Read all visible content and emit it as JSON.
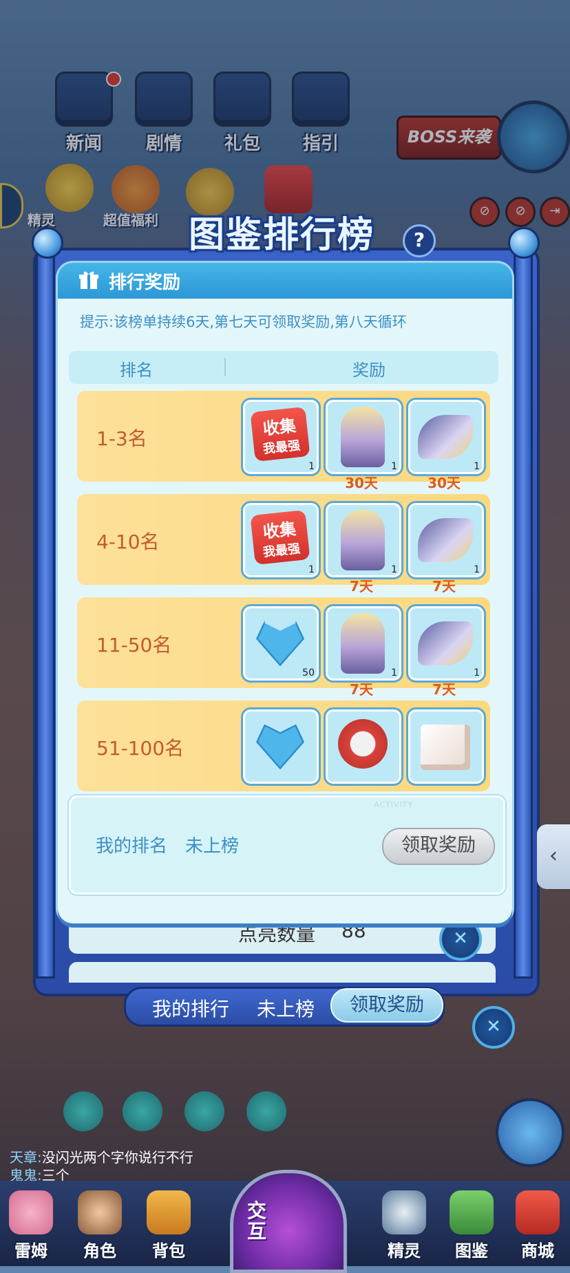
{
  "top_menu": [
    {
      "label": "新闻",
      "icon": "news-icon",
      "badge": true
    },
    {
      "label": "剧情",
      "icon": "story-icon",
      "badge": false
    },
    {
      "label": "礼包",
      "icon": "gift-pack-icon",
      "badge": false
    },
    {
      "label": "指引",
      "icon": "guide-icon",
      "badge": false
    }
  ],
  "boss_label": "BOSS来袭",
  "side_labels": {
    "elf": "精灵",
    "welfare": "超值福利"
  },
  "panel": {
    "banner_title": "图鉴排行榜",
    "header_title": "排行奖励",
    "tip": "提示:该榜单持续6天,第七天可领取奖励,第八天循环",
    "col_rank": "排名",
    "col_reward": "奖励",
    "rows": [
      {
        "rank": "1-3名",
        "items": [
          {
            "icon": "collect-strongest-card-icon",
            "qty": "1",
            "days": ""
          },
          {
            "icon": "armor-mecha-icon",
            "qty": "1",
            "days": "30天"
          },
          {
            "icon": "wings-icon",
            "qty": "1",
            "days": "30天"
          }
        ]
      },
      {
        "rank": "4-10名",
        "items": [
          {
            "icon": "collect-strongest-card-icon",
            "qty": "1",
            "days": ""
          },
          {
            "icon": "armor-mecha-icon",
            "qty": "1",
            "days": "7天"
          },
          {
            "icon": "wings-icon",
            "qty": "1",
            "days": "7天"
          }
        ]
      },
      {
        "rank": "11-50名",
        "items": [
          {
            "icon": "diamond-heart-icon",
            "qty": "50",
            "days": ""
          },
          {
            "icon": "armor-mecha-icon",
            "qty": "1",
            "days": "7天"
          },
          {
            "icon": "wings-icon",
            "qty": "1",
            "days": "7天"
          }
        ]
      },
      {
        "rank": "51-100名",
        "items": [
          {
            "icon": "diamond-heart-icon",
            "qty": "",
            "days": ""
          },
          {
            "icon": "lightning-badge-icon",
            "qty": "",
            "days": ""
          },
          {
            "icon": "sugar-cubes-icon",
            "qty": "",
            "days": ""
          }
        ]
      }
    ],
    "card_texts": {
      "collect_line1": "收集",
      "collect_line2": "我最强"
    },
    "my_rank_label": "我的排名",
    "my_rank_value": "未上榜",
    "claim_button": "领取奖励",
    "activity_tag": "ACTIVITY"
  },
  "background": {
    "behind_row_text": "点亮数量",
    "behind_row_value": "88",
    "my_rank_label": "我的排行",
    "my_rank_value": "未上榜",
    "claim_button": "领取奖励"
  },
  "chat": [
    {
      "name": "天章:",
      "text": "没闪光两个字你说行不行"
    },
    {
      "name": "鬼鬼:",
      "text": "三个"
    }
  ],
  "bottom_nav": [
    {
      "label": "雷姆",
      "icon": "leimu-icon"
    },
    {
      "label": "角色",
      "icon": "character-icon"
    },
    {
      "label": "背包",
      "icon": "backpack-icon"
    },
    {
      "label": "精灵",
      "icon": "elf-icon"
    },
    {
      "label": "图鉴",
      "icon": "codex-icon"
    },
    {
      "label": "商城",
      "icon": "shop-icon"
    }
  ],
  "center_button": {
    "line1": "交",
    "line2": "互"
  },
  "colors": {
    "accent": "#2d97d6",
    "row_bg": "#fcd87e",
    "rank_text": "#c25a2e",
    "days_text": "#e05a1a"
  }
}
